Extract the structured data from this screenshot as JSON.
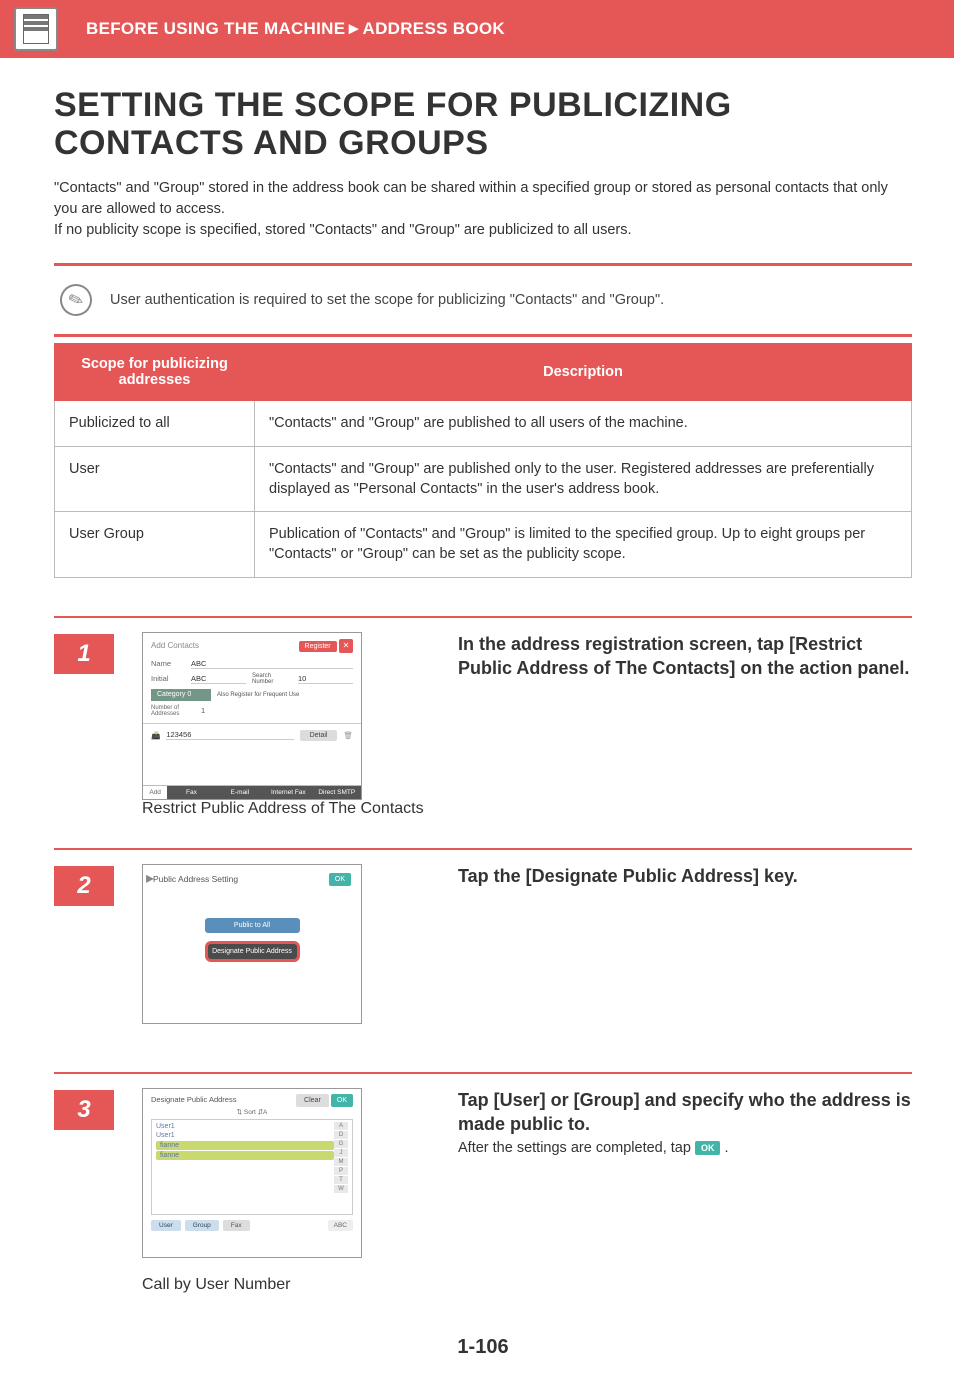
{
  "breadcrumb": "BEFORE USING THE MACHINE►ADDRESS BOOK",
  "title": "SETTING THE SCOPE FOR PUBLICIZING CONTACTS AND GROUPS",
  "intro": "\"Contacts\" and \"Group\" stored in the address book can be shared within a specified group or stored as personal contacts that only you are allowed to access.\n If no publicity scope is specified, stored \"Contacts\" and \"Group\" are publicized to all users.",
  "note": "User authentication is required to set the scope for publicizing \"Contacts\" and \"Group\".",
  "table": {
    "headers": [
      "Scope for publicizing addresses",
      "Description"
    ],
    "rows": [
      {
        "scope": "Publicized to all",
        "desc": "\"Contacts\" and \"Group\" are published to all users of the machine."
      },
      {
        "scope": "User",
        "desc": "\"Contacts\" and \"Group\" are published only to the user. Registered addresses are preferentially displayed as \"Personal Contacts\" in the user's address book."
      },
      {
        "scope": "User Group",
        "desc": "Publication of \"Contacts\" and \"Group\" is limited to the specified group. Up to eight groups per \"Contacts\" or \"Group\" can be set as the publicity scope."
      }
    ]
  },
  "steps": {
    "s1": {
      "num": "1",
      "heading": "In the address registration screen, tap [Restrict Public Address of The Contacts] on the action panel.",
      "mock": {
        "screen_title": "Add Contacts",
        "register": "Register",
        "name_lbl": "Name",
        "name_val": "ABC",
        "initial_lbl": "Initial",
        "initial_val": "ABC",
        "search_lbl": "Search Number",
        "search_val": "10",
        "category": "Category 0",
        "also_reg": "Also Register for Frequent Use",
        "numaddr_lbl": "Number of Addresses",
        "numaddr_val": "1",
        "faxno": "123456",
        "detail": "Detail",
        "tabs": {
          "add": "Add",
          "fax": "Fax",
          "email": "E-mail",
          "ifax": "Internet Fax",
          "smtp": "Direct SMTP"
        },
        "action_panel_item": "Restrict Public Address of The Contacts"
      }
    },
    "s2": {
      "num": "2",
      "heading": "Tap the [Designate Public Address] key.",
      "mock": {
        "screen_title": "Public Address Setting",
        "ok": "OK",
        "btn_all": "Public to All",
        "btn_designate": "Designate Public Address"
      }
    },
    "s3": {
      "num": "3",
      "heading": "Tap [User] or [Group] and specify who the address is made public to.",
      "sub_before": "After the settings are completed, tap ",
      "sub_ok": "OK",
      "sub_after": " .",
      "mock": {
        "screen_title": "Designate Public Address",
        "clear": "Clear",
        "ok": "OK",
        "sort": "Sort",
        "items": [
          "User1",
          "User1",
          "fianne",
          "fianne"
        ],
        "alpha": [
          "A",
          "D",
          "G",
          "J",
          "M",
          "P",
          "T",
          "W"
        ],
        "user": "User",
        "group": "Group",
        "fax": "Fax",
        "abc": "ABC",
        "action_panel_item": "Call by User Number"
      }
    }
  },
  "page_number": "1-106"
}
